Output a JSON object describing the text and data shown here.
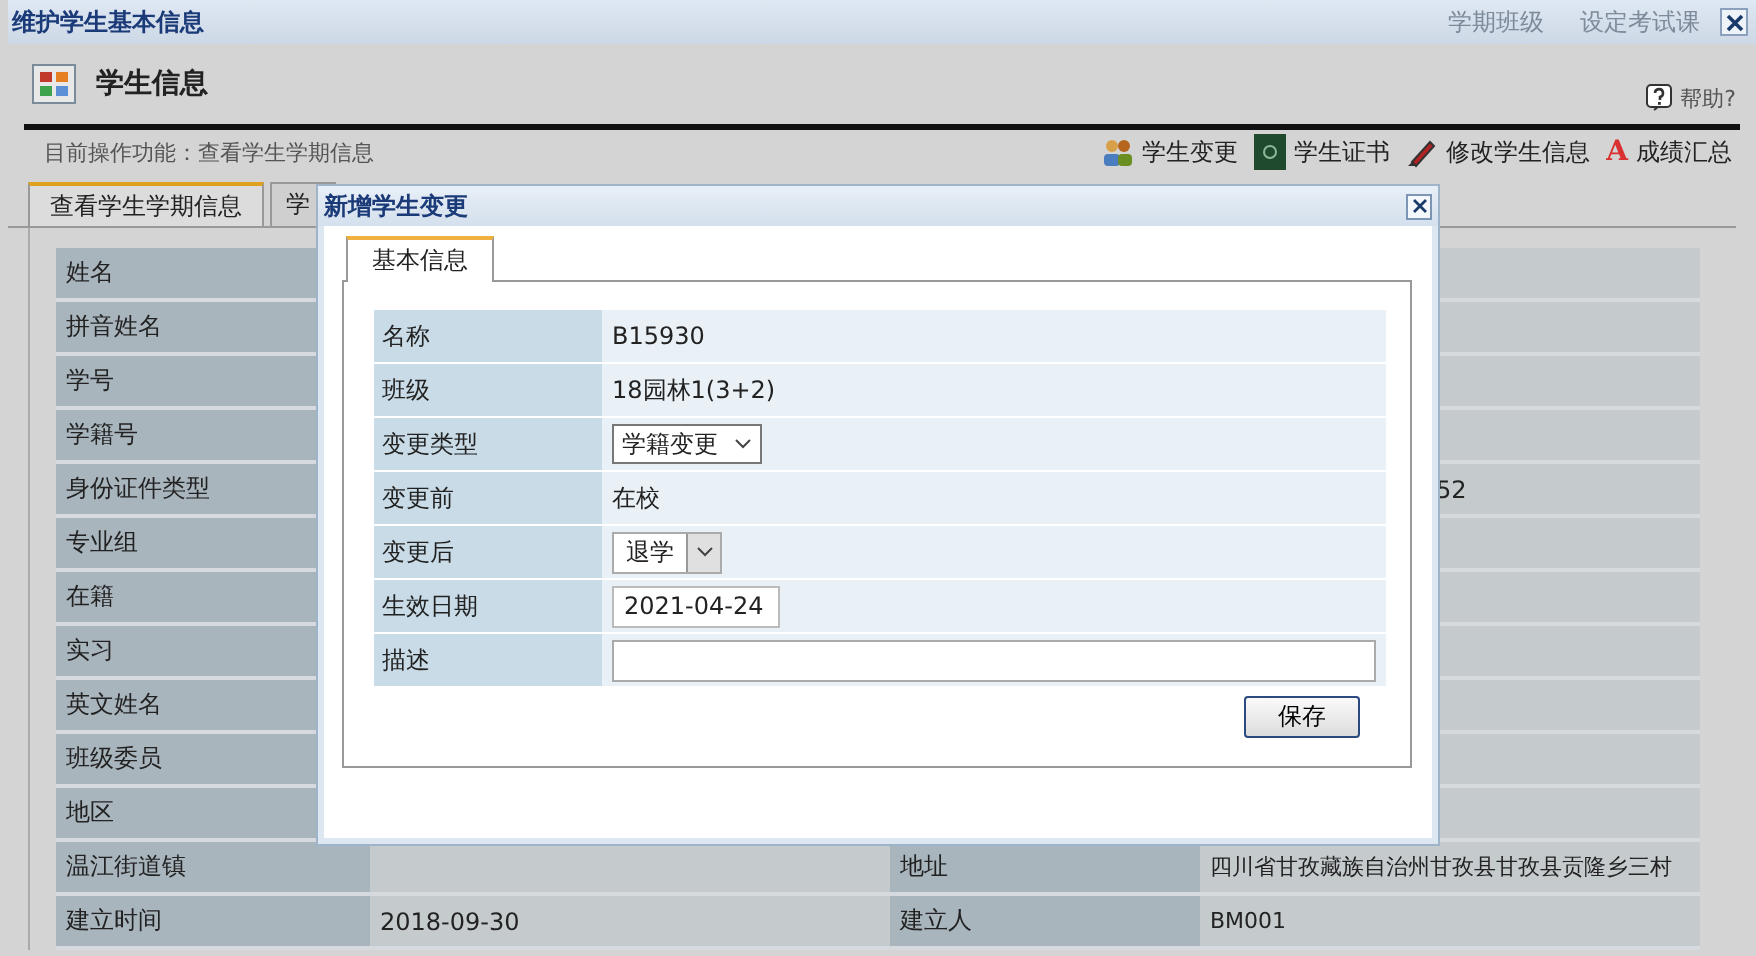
{
  "window": {
    "title": "维护学生基本信息",
    "background_links": [
      "学期班级",
      "设定考试课"
    ]
  },
  "header": {
    "title": "学生信息",
    "help": "帮助?"
  },
  "operation": "目前操作功能：查看学生学期信息",
  "actions": [
    {
      "label": "学生变更"
    },
    {
      "label": "学生证书"
    },
    {
      "label": "修改学生信息"
    },
    {
      "label": "成绩汇总",
      "glyph": "A"
    }
  ],
  "tabs": [
    {
      "label": "查看学生学期信息",
      "selected": true
    },
    {
      "label": "学",
      "selected": false
    }
  ],
  "info_rows": [
    {
      "label": "姓名"
    },
    {
      "label": "拼音姓名"
    },
    {
      "label": "学号"
    },
    {
      "label": "学籍号"
    },
    {
      "label": "身份证件类型",
      "value_2": "52"
    },
    {
      "label": "专业组"
    },
    {
      "label": "在籍"
    },
    {
      "label": "实习"
    },
    {
      "label": "英文姓名"
    },
    {
      "label": "班级委员"
    },
    {
      "label": "地区"
    },
    {
      "label": "温江街道镇",
      "label_2": "地址",
      "value_2": "四川省甘孜藏族自治州甘孜县甘孜县贡隆乡三村"
    },
    {
      "label": "建立时间",
      "value": "2018-09-30",
      "label_2": "建立人",
      "value_2": "BM001"
    }
  ],
  "dialog": {
    "title": "新增学生变更",
    "tabs": [
      {
        "label": "基本信息",
        "selected": true
      }
    ],
    "fields": [
      {
        "kind": "text",
        "label": "名称",
        "value": "B15930"
      },
      {
        "kind": "text",
        "label": "班级",
        "value": "18园林1(3+2)"
      },
      {
        "kind": "select",
        "label": "变更类型",
        "value": "学籍变更"
      },
      {
        "kind": "text",
        "label": "变更前",
        "value": "在校"
      },
      {
        "kind": "combo",
        "label": "变更后",
        "value": "退学"
      },
      {
        "kind": "input",
        "label": "生效日期",
        "value": "2021-04-24"
      },
      {
        "kind": "textarea",
        "label": "描述"
      }
    ],
    "save": "保存"
  }
}
